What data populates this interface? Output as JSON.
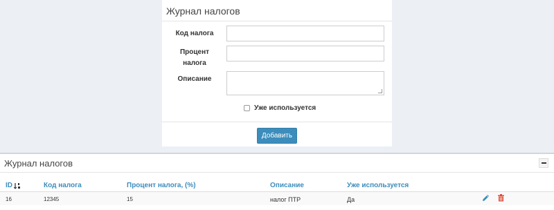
{
  "form": {
    "title": "Журнал налогов",
    "tax_code_label": "Код налога",
    "tax_percent_label_line1": "Процент",
    "tax_percent_label_line2": "налога",
    "description_label": "Описание",
    "tax_code_value": "",
    "tax_percent_value": "",
    "description_value": "",
    "in_use_label": "Уже используется",
    "in_use_checked": false,
    "add_button": "Добавить"
  },
  "list": {
    "title": "Журнал налогов",
    "columns": [
      "ID",
      "Код налога",
      "Процент налога, (%)",
      "Описание",
      "Уже используется"
    ],
    "rows": [
      {
        "id": "16",
        "code": "12345",
        "percent": "15",
        "description": "налог ПТР",
        "in_use": "Да"
      }
    ]
  },
  "icons": {
    "sort": "sort-icon",
    "edit": "pencil-icon",
    "delete": "trash-icon",
    "collapse": "minus-icon"
  },
  "colors": {
    "accent": "#3c8dbc",
    "delete": "#dd4b39",
    "background": "#ecf0f5"
  }
}
